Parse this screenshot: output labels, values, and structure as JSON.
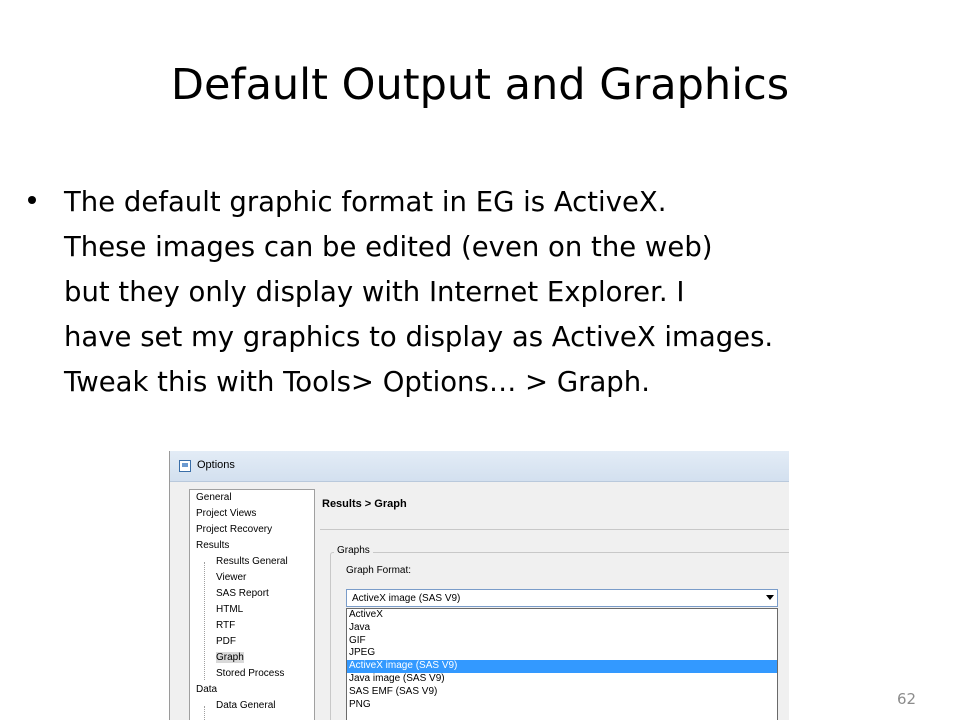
{
  "slide": {
    "title": "Default Output and Graphics",
    "bullet_lines": [
      "The default graphic format in EG is ActiveX.",
      "These images can be edited (even on the web)",
      "but they only display with Internet Explorer.  I",
      "have set my graphics to display as ActiveX images.",
      "Tweak this with Tools> Options… > Graph."
    ],
    "page_number": "62"
  },
  "dialog": {
    "title": "Options",
    "tree": [
      {
        "label": "General",
        "level": 0
      },
      {
        "label": "Project Views",
        "level": 0
      },
      {
        "label": "Project Recovery",
        "level": 0
      },
      {
        "label": "Results",
        "level": 0
      },
      {
        "label": "Results General",
        "level": 1
      },
      {
        "label": "Viewer",
        "level": 1
      },
      {
        "label": "SAS Report",
        "level": 1
      },
      {
        "label": "HTML",
        "level": 1
      },
      {
        "label": "RTF",
        "level": 1
      },
      {
        "label": "PDF",
        "level": 1
      },
      {
        "label": "Graph",
        "level": 1,
        "selected": true
      },
      {
        "label": "Stored Process",
        "level": 1
      },
      {
        "label": "Data",
        "level": 0
      },
      {
        "label": "Data General",
        "level": 1
      }
    ],
    "panel_heading": "Results > Graph",
    "group_label": "Graphs",
    "field_label": "Graph Format:",
    "selected_value": "ActiveX image (SAS V9)",
    "options": [
      "ActiveX",
      "Java",
      "GIF",
      "JPEG",
      "ActiveX image (SAS V9)",
      "Java image (SAS V9)",
      "SAS EMF (SAS V9)",
      "PNG"
    ],
    "highlighted_option_index": 4,
    "highlight_color": "#3399ff"
  }
}
